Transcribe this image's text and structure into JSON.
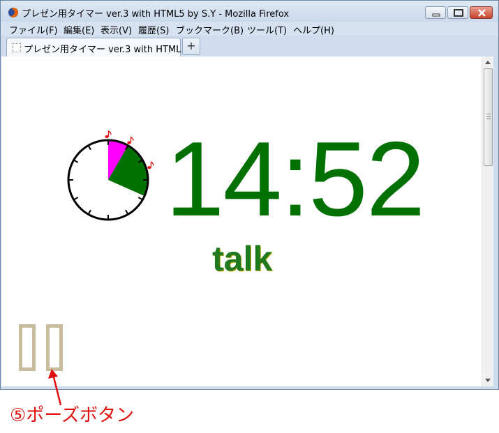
{
  "window": {
    "title": "プレゼン用タイマー ver.3 with HTML5 by S.Y - Mozilla Firefox"
  },
  "menu": [
    {
      "label": "ファイル(F)"
    },
    {
      "label": "編集(E)"
    },
    {
      "label": "表示(V)"
    },
    {
      "label": "履歴(S)"
    },
    {
      "label": "ブックマーク(B)"
    },
    {
      "label": "ツール(T)"
    },
    {
      "label": "ヘルプ(H)"
    }
  ],
  "tabs": [
    {
      "label": "プレゼン用タイマー ver.3 with HTML..."
    }
  ],
  "new_tab_label": "+",
  "timer": {
    "time": "14:52",
    "phase": "talk",
    "time_color": "#007000",
    "phase_color": "#1f7a1f"
  },
  "clock": {
    "bell_icon": "music-note-icon",
    "bell_marks_minutes": [
      0,
      5,
      12
    ],
    "elapsed_minutes": 19,
    "sectors": [
      {
        "from_minute": 0,
        "to_minute": 5,
        "color": "#ff00ff"
      },
      {
        "from_minute": 5,
        "to_minute": 19,
        "color": "#007000"
      }
    ]
  },
  "pause_button": {
    "icon": "pause-icon",
    "color": "#c8bc9c"
  },
  "annotation": {
    "text": "⑤ポーズボタン",
    "color": "#e01010"
  }
}
